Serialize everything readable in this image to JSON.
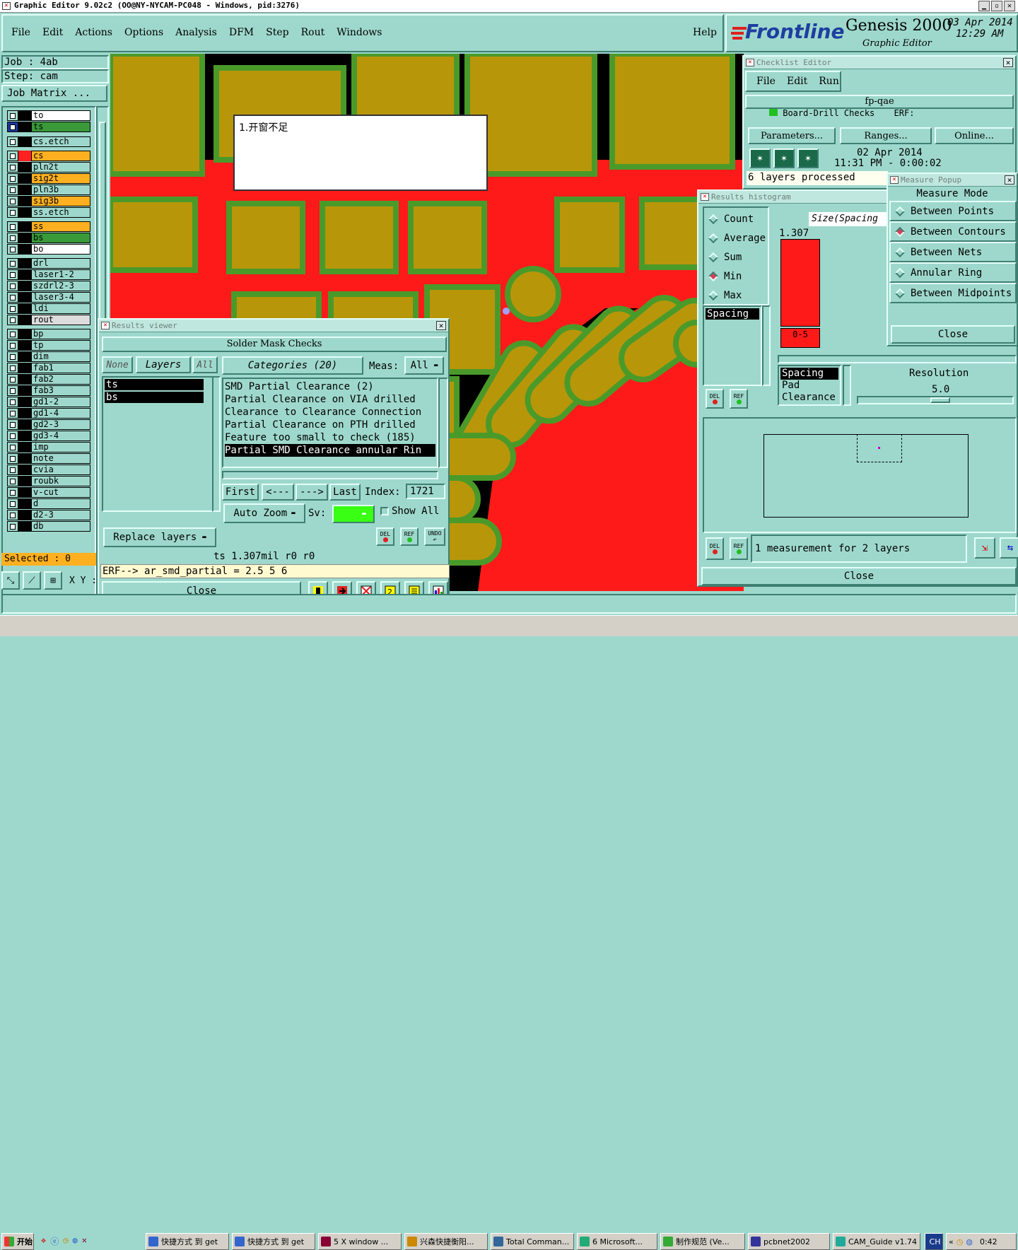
{
  "titlebar": {
    "text": "Graphic Editor 9.02c2 (OO@NY-NYCAM-PC048 - Windows, pid:3276)"
  },
  "menu": [
    "File",
    "Edit",
    "Actions",
    "Options",
    "Analysis",
    "DFM",
    "Step",
    "Rout",
    "Windows"
  ],
  "help_label": "Help",
  "brand": {
    "logo": "Frontline",
    "product": "Genesis 2000",
    "subtitle": "Graphic Editor",
    "date": "03 Apr 2014",
    "time": "12:29 AM"
  },
  "job": {
    "job": "Job : 4ab",
    "step": "Step: cam",
    "matrix": "Job Matrix ..."
  },
  "layers": [
    {
      "name": "to",
      "color": "#ffffff",
      "sel": false
    },
    {
      "name": "ts",
      "color": "#3a9a3a",
      "sel": true
    },
    {
      "name": "cs.etch",
      "color": "#9ed8cc",
      "sel": false
    },
    {
      "name": "cs",
      "color": "#ffb020",
      "sel": false,
      "sw": "#ff2020"
    },
    {
      "name": "pln2t",
      "color": "#9ed8cc",
      "sel": false
    },
    {
      "name": "sig2t",
      "color": "#ffb020",
      "sel": false
    },
    {
      "name": "pln3b",
      "color": "#9ed8cc",
      "sel": false
    },
    {
      "name": "sig3b",
      "color": "#ffb020",
      "sel": false
    },
    {
      "name": "ss.etch",
      "color": "#9ed8cc",
      "sel": false
    },
    {
      "name": "ss",
      "color": "#ffb020",
      "sel": false
    },
    {
      "name": "bs",
      "color": "#3a9a3a",
      "sel": false
    },
    {
      "name": "bo",
      "color": "#ffffff",
      "sel": false
    },
    {
      "name": "drl",
      "color": "#9ed8cc",
      "sel": false
    },
    {
      "name": "laser1-2",
      "color": "#9ed8cc",
      "sel": false
    },
    {
      "name": "szdrl2-3",
      "color": "#9ed8cc",
      "sel": false
    },
    {
      "name": "laser3-4",
      "color": "#9ed8cc",
      "sel": false
    },
    {
      "name": "ldi",
      "color": "#9ed8cc",
      "sel": false
    },
    {
      "name": "rout",
      "color": "#dcdcdc",
      "sel": false
    },
    {
      "name": "bp",
      "color": "#9ed8cc",
      "sel": false
    },
    {
      "name": "tp",
      "color": "#9ed8cc",
      "sel": false
    },
    {
      "name": "dim",
      "color": "#9ed8cc",
      "sel": false
    },
    {
      "name": "fab1",
      "color": "#9ed8cc",
      "sel": false
    },
    {
      "name": "fab2",
      "color": "#9ed8cc",
      "sel": false
    },
    {
      "name": "fab3",
      "color": "#9ed8cc",
      "sel": false
    },
    {
      "name": "gd1-2",
      "color": "#9ed8cc",
      "sel": false
    },
    {
      "name": "gd1-4",
      "color": "#9ed8cc",
      "sel": false
    },
    {
      "name": "gd2-3",
      "color": "#9ed8cc",
      "sel": false
    },
    {
      "name": "gd3-4",
      "color": "#9ed8cc",
      "sel": false
    },
    {
      "name": "imp",
      "color": "#9ed8cc",
      "sel": false
    },
    {
      "name": "note",
      "color": "#9ed8cc",
      "sel": false
    },
    {
      "name": "cvia",
      "color": "#9ed8cc",
      "sel": false
    },
    {
      "name": "roubk",
      "color": "#9ed8cc",
      "sel": false
    },
    {
      "name": "v-cut",
      "color": "#9ed8cc",
      "sel": false
    },
    {
      "name": "d",
      "color": "#9ed8cc",
      "sel": false
    },
    {
      "name": "d2-3",
      "color": "#9ed8cc",
      "sel": false
    },
    {
      "name": "db",
      "color": "#9ed8cc",
      "sel": false
    }
  ],
  "selected": "Selected : 0",
  "xy_label": "X Y :",
  "note_text": "1.开窗不足",
  "results_viewer": {
    "title": "Results viewer",
    "section": "Solder Mask Checks",
    "none": "None",
    "layers": "Layers",
    "all": "All",
    "categories": "Categories (20)",
    "meas": "Meas:",
    "meas_val": "All",
    "layer_list": [
      "ts",
      "bs"
    ],
    "items": [
      "SMD Partial Clearance (2)",
      "Partial Clearance on VIA drilled",
      "Clearance to Clearance Connection",
      "Partial Clearance on PTH drilled",
      "Feature too small to check (185)",
      "Partial SMD Clearance annular Rin"
    ],
    "first": "First",
    "prev": "<---",
    "next": "--->",
    "last": "Last",
    "index_label": "Index:",
    "index_val": "1721",
    "auto_zoom": "Auto Zoom",
    "sv": "Sv:",
    "show_all": "Show All",
    "replace": "Replace layers",
    "info": "ts 1.307mil  r0  r0",
    "erf": "ERF--> ar_smd_partial = 2.5 5 6",
    "close": "Close",
    "del": "DEL",
    "ref": "REF",
    "undo": "UNDO"
  },
  "checklist": {
    "title": "Checklist Editor",
    "menu": [
      "File",
      "Edit",
      "Run"
    ],
    "name": "fp-qae",
    "row": "Board-Drill Checks",
    "row_erf": "ERF:",
    "params": "Parameters...",
    "ranges": "Ranges...",
    "online": "Online...",
    "date": "02 Apr 2014",
    "time": "11:31 PM - 0:00:02",
    "status": "6 layers processed"
  },
  "histogram": {
    "title": "Results histogram",
    "options": [
      {
        "label": "Count",
        "on": false
      },
      {
        "label": "Average",
        "on": false
      },
      {
        "label": "Sum",
        "on": false
      },
      {
        "label": "Min",
        "on": true
      },
      {
        "label": "Max",
        "on": false
      }
    ],
    "list": [
      "Spacing"
    ],
    "axis": "Size(Spacing",
    "bar_value": "1.307",
    "bar_range": "0-5",
    "attr": [
      "Spacing",
      "Pad",
      "Clearance"
    ],
    "resolution_label": "Resolution",
    "resolution_val": "5.0",
    "del": "DEL",
    "ref": "REF",
    "measure_text": "1 measurement for 2 layers",
    "close": "Close"
  },
  "measure": {
    "title": "Measure Popup",
    "mode": "Measure Mode",
    "options": [
      {
        "label": "Between Points",
        "on": false
      },
      {
        "label": "Between Contours",
        "on": true
      },
      {
        "label": "Between Nets",
        "on": false
      },
      {
        "label": "Annular Ring",
        "on": false
      },
      {
        "label": "Between Midpoints",
        "on": false
      }
    ],
    "close": "Close"
  },
  "taskbar": {
    "start": "开始",
    "items": [
      "快捷方式 到 get",
      "快捷方式 到 get",
      "5 X window ...",
      "兴森快捷衡阳...",
      "Total Comman...",
      "6 Microsoft...",
      "制作规范 (Ve...",
      "pcbnet2002",
      "CAM_Guide v1.74"
    ],
    "lang": "CH",
    "clock": "0:42"
  },
  "colors": {
    "bg": "#9ed8cc",
    "copper": "#b8960a",
    "mask_green": "#4a9a2a",
    "red": "#ff1a1a"
  }
}
